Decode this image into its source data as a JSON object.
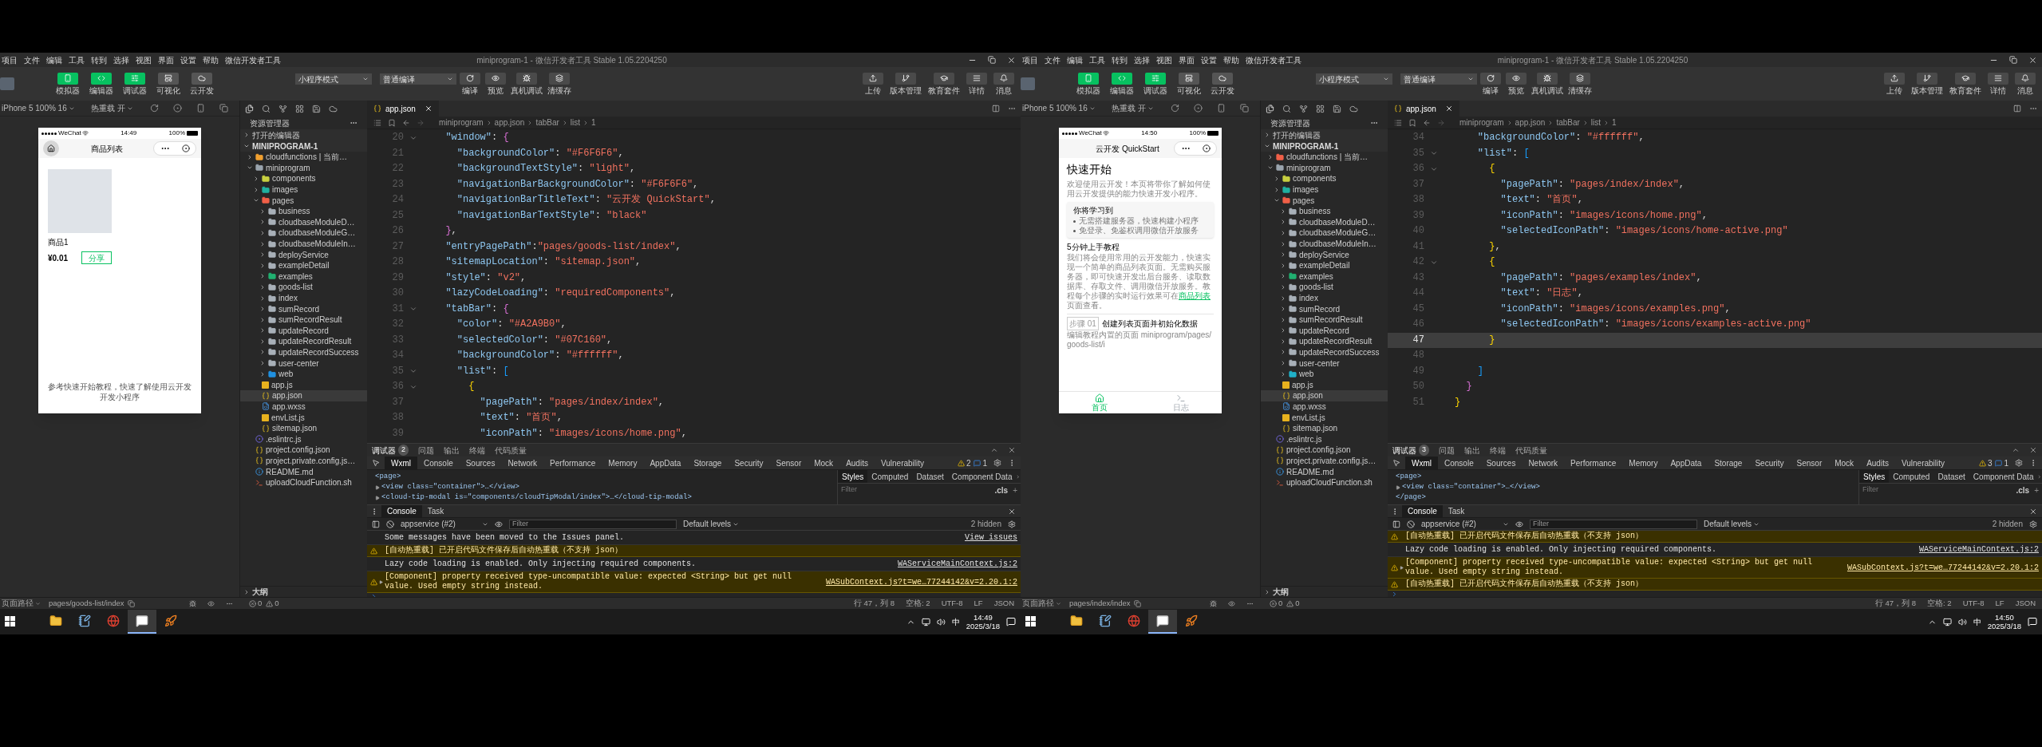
{
  "windows": [
    {
      "menu": [
        "项目",
        "文件",
        "编辑",
        "工具",
        "转到",
        "选择",
        "视图",
        "界面",
        "设置",
        "帮助",
        "微信开发者工具"
      ],
      "title": "miniprogram-1 - 微信开发者工具 Stable 1.05.2204250",
      "mode_buttons": [
        {
          "label": "模拟器",
          "kind": "simulator",
          "on": true
        },
        {
          "label": "编辑器",
          "kind": "editor",
          "on": true
        },
        {
          "label": "调试器",
          "kind": "debugger",
          "on": true
        },
        {
          "label": "可视化",
          "kind": "visual",
          "on": false
        },
        {
          "label": "云开发",
          "kind": "cloud",
          "on": false
        }
      ],
      "mode_select": "小程序模式",
      "compile_select": "普通编译",
      "compile_actions": [
        {
          "label": "编译",
          "kind": "compile"
        },
        {
          "label": "预览",
          "kind": "preview"
        },
        {
          "label": "真机调试",
          "kind": "device"
        },
        {
          "label": "清缓存",
          "kind": "cache"
        }
      ],
      "right_actions": [
        {
          "label": "上传",
          "kind": "upload"
        },
        {
          "label": "版本管理",
          "kind": "version"
        },
        {
          "label": "教育套件",
          "kind": "edu"
        },
        {
          "label": "详情",
          "kind": "details"
        },
        {
          "label": "消息",
          "kind": "messages"
        }
      ],
      "simulator": {
        "device": "iPhone 5 100% 16",
        "hot_reload": "热重载 开",
        "phone": {
          "kind": "goods",
          "carrier": "WeChat",
          "time": "14:49",
          "battery": "100%",
          "home_button": true,
          "title": "商品列表",
          "product": {
            "name": "商品1",
            "price": "¥0.01",
            "button": "分享"
          },
          "footer": "参考快速开始教程，快速了解使用云开发开发小程序"
        }
      },
      "explorer": {
        "title": "资源管理器",
        "open_editors": "打开的编辑器",
        "project": "MINIPROGRAM-1",
        "outline": "大纲",
        "tree": [
          {
            "name": "cloudfunctions | 当前…",
            "kind": "folder",
            "color": "#f0a030",
            "expanded": false,
            "selected": false
          },
          {
            "name": "miniprogram",
            "kind": "folder",
            "color": "#9aa4ad",
            "expanded": true,
            "selected": false,
            "children": [
              {
                "name": "components",
                "kind": "folder",
                "color": "#c8d040",
                "expanded": false,
                "selected": false
              },
              {
                "name": "images",
                "kind": "folder",
                "color": "#20b0a0",
                "expanded": false,
                "selected": false
              },
              {
                "name": "pages",
                "kind": "folder",
                "color": "#f06048",
                "expanded": true,
                "selected": false,
                "children": [
                  {
                    "name": "business",
                    "kind": "folder",
                    "color": "#a8b0b8",
                    "expanded": false,
                    "selected": false
                  },
                  {
                    "name": "cloudbaseModuleD…",
                    "kind": "folder",
                    "color": "#a8b0b8",
                    "expanded": false,
                    "selected": false
                  },
                  {
                    "name": "cloudbaseModuleG…",
                    "kind": "folder",
                    "color": "#a8b0b8",
                    "expanded": false,
                    "selected": false
                  },
                  {
                    "name": "cloudbaseModuleIn…",
                    "kind": "folder",
                    "color": "#a8b0b8",
                    "expanded": false,
                    "selected": false
                  },
                  {
                    "name": "deployService",
                    "kind": "folder",
                    "color": "#a8b0b8",
                    "expanded": false,
                    "selected": false
                  },
                  {
                    "name": "exampleDetail",
                    "kind": "folder",
                    "color": "#a8b0b8",
                    "expanded": false,
                    "selected": false
                  },
                  {
                    "name": "examples",
                    "kind": "folder",
                    "color": "#20b070",
                    "expanded": false,
                    "selected": false
                  },
                  {
                    "name": "goods-list",
                    "kind": "folder",
                    "color": "#a8b0b8",
                    "expanded": false,
                    "selected": false
                  },
                  {
                    "name": "index",
                    "kind": "folder",
                    "color": "#a8b0b8",
                    "expanded": false,
                    "selected": false
                  },
                  {
                    "name": "sumRecord",
                    "kind": "folder",
                    "color": "#a8b0b8",
                    "expanded": false,
                    "selected": false
                  },
                  {
                    "name": "sumRecordResult",
                    "kind": "folder",
                    "color": "#a8b0b8",
                    "expanded": false,
                    "selected": false
                  },
                  {
                    "name": "updateRecord",
                    "kind": "folder",
                    "color": "#a8b0b8",
                    "expanded": false,
                    "selected": false
                  },
                  {
                    "name": "updateRecordResult",
                    "kind": "folder",
                    "color": "#a8b0b8",
                    "expanded": false,
                    "selected": false
                  },
                  {
                    "name": "updateRecordSuccess",
                    "kind": "folder",
                    "color": "#a8b0b8",
                    "expanded": false,
                    "selected": false
                  },
                  {
                    "name": "user-center",
                    "kind": "folder",
                    "color": "#a8b0b8",
                    "expanded": false,
                    "selected": false
                  },
                  {
                    "name": "web",
                    "kind": "folder",
                    "color": "#2090e0",
                    "expanded": false,
                    "selected": false
                  }
                ]
              },
              {
                "name": "app.js",
                "kind": "js",
                "selected": false
              },
              {
                "name": "app.json",
                "kind": "json",
                "selected": true
              },
              {
                "name": "app.wxss",
                "kind": "wxss",
                "selected": false
              },
              {
                "name": "envList.js",
                "kind": "js",
                "selected": false
              },
              {
                "name": "sitemap.json",
                "kind": "json",
                "selected": false
              }
            ]
          },
          {
            "name": ".eslintrc.js",
            "kind": "eslint",
            "selected": false
          },
          {
            "name": "project.config.json",
            "kind": "json",
            "selected": false
          },
          {
            "name": "project.private.config.js…",
            "kind": "json",
            "selected": false
          },
          {
            "name": "README.md",
            "kind": "info",
            "selected": false
          },
          {
            "name": "uploadCloudFunction.sh",
            "kind": "shell",
            "selected": false
          }
        ]
      },
      "editor": {
        "tab": "app.json",
        "breadcrumb": [
          "miniprogram",
          "app.json",
          "tabBar",
          "list",
          "1"
        ],
        "lines": [
          {
            "n": "20",
            "text": "  \"window\": {",
            "fold": true,
            "current": false
          },
          {
            "n": "21",
            "text": "    \"backgroundColor\": \"#F6F6F6\",",
            "fold": false,
            "current": false
          },
          {
            "n": "22",
            "text": "    \"backgroundTextStyle\": \"light\",",
            "fold": false,
            "current": false
          },
          {
            "n": "23",
            "text": "    \"navigationBarBackgroundColor\": \"#F6F6F6\",",
            "fold": false,
            "current": false
          },
          {
            "n": "24",
            "text": "    \"navigationBarTitleText\": \"云开发 QuickStart\",",
            "fold": false,
            "current": false
          },
          {
            "n": "25",
            "text": "    \"navigationBarTextStyle\": \"black\"",
            "fold": false,
            "current": false
          },
          {
            "n": "26",
            "text": "  },",
            "fold": false,
            "current": false
          },
          {
            "n": "27",
            "text": "  \"entryPagePath\":\"pages/goods-list/index\",",
            "fold": false,
            "current": false
          },
          {
            "n": "28",
            "text": "  \"sitemapLocation\": \"sitemap.json\",",
            "fold": false,
            "current": false
          },
          {
            "n": "29",
            "text": "  \"style\": \"v2\",",
            "fold": false,
            "current": false
          },
          {
            "n": "30",
            "text": "  \"lazyCodeLoading\": \"requiredComponents\",",
            "fold": false,
            "current": false
          },
          {
            "n": "31",
            "text": "  \"tabBar\": {",
            "fold": true,
            "current": false
          },
          {
            "n": "32",
            "text": "    \"color\": \"#A2A9B0\",",
            "fold": false,
            "current": false
          },
          {
            "n": "33",
            "text": "    \"selectedColor\": \"#07C160\",",
            "fold": false,
            "current": false
          },
          {
            "n": "34",
            "text": "    \"backgroundColor\": \"#ffffff\",",
            "fold": false,
            "current": false
          },
          {
            "n": "35",
            "text": "    \"list\": [",
            "fold": true,
            "current": false
          },
          {
            "n": "36",
            "text": "      {",
            "fold": true,
            "current": false
          },
          {
            "n": "37",
            "text": "        \"pagePath\": \"pages/index/index\",",
            "fold": false,
            "current": false
          },
          {
            "n": "38",
            "text": "        \"text\": \"首页\",",
            "fold": false,
            "current": false
          },
          {
            "n": "39",
            "text": "        \"iconPath\": \"images/icons/home.png\",",
            "fold": false,
            "current": false
          }
        ]
      },
      "devtools": {
        "panel_tabs": [
          {
            "label": "调试器",
            "badge": "2",
            "selected": true
          },
          {
            "label": "问题",
            "selected": false
          },
          {
            "label": "输出",
            "selected": false
          },
          {
            "label": "终端",
            "selected": false
          },
          {
            "label": "代码质量",
            "selected": false
          }
        ],
        "tool_tabs": [
          {
            "label": "Wxml",
            "selected": true
          },
          {
            "label": "Console",
            "selected": false
          },
          {
            "label": "Sources",
            "selected": false
          },
          {
            "label": "Network",
            "selected": false
          },
          {
            "label": "Performance",
            "selected": false
          },
          {
            "label": "Memory",
            "selected": false
          },
          {
            "label": "AppData",
            "selected": false
          },
          {
            "label": "Storage",
            "selected": false
          },
          {
            "label": "Security",
            "selected": false
          },
          {
            "label": "Sensor",
            "selected": false
          },
          {
            "label": "Mock",
            "selected": false
          },
          {
            "label": "Audits",
            "selected": false
          },
          {
            "label": "Vulnerability",
            "selected": false
          }
        ],
        "warning_count": "2",
        "message_count": "1",
        "wxml": [
          {
            "text": "<page>",
            "expandable": false
          },
          {
            "text": "<view class=\"container\">…</view>",
            "expandable": true
          },
          {
            "text": "<cloud-tip-modal is=\"components/cloudTipModal/index\">…</cloud-tip-modal>",
            "expandable": true
          }
        ],
        "style_tabs": [
          {
            "label": "Styles",
            "selected": true
          },
          {
            "label": "Computed",
            "selected": false
          },
          {
            "label": "Dataset",
            "selected": false
          },
          {
            "label": "Component Data",
            "selected": false
          }
        ],
        "styles_filter": {
          "placeholder": "Filter"
        },
        "cls": ".cls",
        "add": "+",
        "drawer_tabs": [
          {
            "label": "Console",
            "selected": true
          },
          {
            "label": "Task",
            "selected": false
          }
        ],
        "context": "appservice (#2)",
        "console_filter": {
          "placeholder": "Filter"
        },
        "levels": "Default levels",
        "hidden": "2 hidden",
        "messages": [
          {
            "kind": "info",
            "text": "Some messages have been moved to the Issues panel.",
            "source": "View issues"
          },
          {
            "kind": "warning",
            "text": "[自动热重载] 已开启代码文件保存后自动热重载（不支持 json）"
          },
          {
            "kind": "info",
            "text": "Lazy code loading is enabled. Only injecting required components.",
            "source": "WAServiceMainContext.js:2"
          },
          {
            "kind": "warning",
            "text": "[Component] property received type-uncompatible value: expected <String> but get null value. Used empty string instead.",
            "source": "WASubContext.js?t=we…77244142&v=2.20.1:2",
            "expandable": true
          }
        ]
      },
      "status_bar": {
        "page_path_label": "页面路径",
        "page_path": "pages/goods-list/index",
        "errors": "0",
        "warnings": "0",
        "position": "行 47，列 8",
        "indent": "空格: 2",
        "encoding": "UTF-8",
        "eol": "LF",
        "language": "JSON"
      },
      "taskbar": {
        "apps": [
          {
            "kind": "folder",
            "active": false
          },
          {
            "kind": "notes",
            "active": false
          },
          {
            "kind": "browser",
            "active": false
          },
          {
            "kind": "wechat-devtools",
            "active": true
          },
          {
            "kind": "orange-app",
            "active": false
          }
        ],
        "ime": "中",
        "time": "14:49",
        "date": "2025/3/18"
      }
    },
    {
      "menu": [
        "项目",
        "文件",
        "编辑",
        "工具",
        "转到",
        "选择",
        "视图",
        "界面",
        "设置",
        "帮助",
        "微信开发者工具"
      ],
      "title": "miniprogram-1 - 微信开发者工具 Stable 1.05.2204250",
      "mode_buttons": [
        {
          "label": "模拟器",
          "kind": "simulator",
          "on": true
        },
        {
          "label": "编辑器",
          "kind": "editor",
          "on": true
        },
        {
          "label": "调试器",
          "kind": "debugger",
          "on": true
        },
        {
          "label": "可视化",
          "kind": "visual",
          "on": false
        },
        {
          "label": "云开发",
          "kind": "cloud",
          "on": false
        }
      ],
      "mode_select": "小程序模式",
      "compile_select": "普通编译",
      "compile_actions": [
        {
          "label": "编译",
          "kind": "compile"
        },
        {
          "label": "预览",
          "kind": "preview"
        },
        {
          "label": "真机调试",
          "kind": "device"
        },
        {
          "label": "清缓存",
          "kind": "cache"
        }
      ],
      "right_actions": [
        {
          "label": "上传",
          "kind": "upload"
        },
        {
          "label": "版本管理",
          "kind": "version"
        },
        {
          "label": "教育套件",
          "kind": "edu"
        },
        {
          "label": "详情",
          "kind": "details"
        },
        {
          "label": "消息",
          "kind": "messages"
        }
      ],
      "simulator": {
        "device": "iPhone 5 100% 16",
        "hot_reload": "热重载 开",
        "phone": {
          "kind": "quickstart",
          "carrier": "WeChat",
          "time": "14:50",
          "battery": "100%",
          "home_button": false,
          "title": "云开发 QuickStart",
          "heading": "快速开始",
          "intro": "欢迎使用云开发！本页将带你了解如何使用云开发提供的能力快速开发小程序。",
          "card": {
            "title": "你将学习到",
            "bullets": [
              "无需搭建服务器，快速构建小程序",
              "免登录、免鉴权调用微信开放服务"
            ]
          },
          "section": "5分钟上手教程",
          "body_before": "我们将会使用常用的云开发能力，快速实现一个简单的商品列表页面。无需购买服务器，即可快速开发出后台服务、读取数据库、存取文件、调用微信开放服务。教程每个步骤的实时运行效果可在",
          "link": "商品列表",
          "body_after": "页面查看。",
          "step": {
            "badge": "步骤 01",
            "title": "创建列表页面并初始化数据",
            "desc": "编辑教程内置的页面 miniprogram/pages/goods-list/i"
          },
          "tabs": [
            {
              "label": "首页",
              "kind": "home",
              "selected": true
            },
            {
              "label": "日志",
              "kind": "log",
              "selected": false
            }
          ]
        }
      },
      "explorer": {
        "title": "资源管理器",
        "open_editors": "打开的编辑器",
        "project": "MINIPROGRAM-1",
        "outline": "大纲",
        "tree": [
          {
            "name": "cloudfunctions | 当前…",
            "kind": "folder",
            "color": "#f06048",
            "expanded": false,
            "selected": false
          },
          {
            "name": "miniprogram",
            "kind": "folder",
            "color": "#9aa4ad",
            "expanded": true,
            "selected": false,
            "children": [
              {
                "name": "components",
                "kind": "folder",
                "color": "#c8d040",
                "expanded": false,
                "selected": false
              },
              {
                "name": "images",
                "kind": "folder",
                "color": "#20b0a0",
                "expanded": false,
                "selected": false
              },
              {
                "name": "pages",
                "kind": "folder",
                "color": "#f06048",
                "expanded": true,
                "selected": false,
                "children": [
                  {
                    "name": "business",
                    "kind": "folder",
                    "color": "#a8b0b8",
                    "expanded": false,
                    "selected": false
                  },
                  {
                    "name": "cloudbaseModuleD…",
                    "kind": "folder",
                    "color": "#a8b0b8",
                    "expanded": false,
                    "selected": false
                  },
                  {
                    "name": "cloudbaseModuleG…",
                    "kind": "folder",
                    "color": "#a8b0b8",
                    "expanded": false,
                    "selected": false
                  },
                  {
                    "name": "cloudbaseModuleIn…",
                    "kind": "folder",
                    "color": "#a8b0b8",
                    "expanded": false,
                    "selected": false
                  },
                  {
                    "name": "deployService",
                    "kind": "folder",
                    "color": "#a8b0b8",
                    "expanded": false,
                    "selected": false
                  },
                  {
                    "name": "exampleDetail",
                    "kind": "folder",
                    "color": "#a8b0b8",
                    "expanded": false,
                    "selected": false
                  },
                  {
                    "name": "examples",
                    "kind": "folder",
                    "color": "#20b070",
                    "expanded": false,
                    "selected": false
                  },
                  {
                    "name": "goods-list",
                    "kind": "folder",
                    "color": "#a8b0b8",
                    "expanded": false,
                    "selected": false
                  },
                  {
                    "name": "index",
                    "kind": "folder",
                    "color": "#a8b0b8",
                    "expanded": false,
                    "selected": false
                  },
                  {
                    "name": "sumRecord",
                    "kind": "folder",
                    "color": "#a8b0b8",
                    "expanded": false,
                    "selected": false
                  },
                  {
                    "name": "sumRecordResult",
                    "kind": "folder",
                    "color": "#a8b0b8",
                    "expanded": false,
                    "selected": false
                  },
                  {
                    "name": "updateRecord",
                    "kind": "folder",
                    "color": "#a8b0b8",
                    "expanded": false,
                    "selected": false
                  },
                  {
                    "name": "updateRecordResult",
                    "kind": "folder",
                    "color": "#a8b0b8",
                    "expanded": false,
                    "selected": false
                  },
                  {
                    "name": "updateRecordSuccess",
                    "kind": "folder",
                    "color": "#a8b0b8",
                    "expanded": false,
                    "selected": false
                  },
                  {
                    "name": "user-center",
                    "kind": "folder",
                    "color": "#a8b0b8",
                    "expanded": false,
                    "selected": false
                  },
                  {
                    "name": "web",
                    "kind": "folder",
                    "color": "#20b0c8",
                    "expanded": false,
                    "selected": false
                  }
                ]
              },
              {
                "name": "app.js",
                "kind": "js",
                "selected": false
              },
              {
                "name": "app.json",
                "kind": "json",
                "selected": true
              },
              {
                "name": "app.wxss",
                "kind": "wxss",
                "selected": false
              },
              {
                "name": "envList.js",
                "kind": "js",
                "selected": false
              },
              {
                "name": "sitemap.json",
                "kind": "json",
                "selected": false
              }
            ]
          },
          {
            "name": ".eslintrc.js",
            "kind": "eslint",
            "selected": false
          },
          {
            "name": "project.config.json",
            "kind": "json",
            "selected": false
          },
          {
            "name": "project.private.config.js…",
            "kind": "json",
            "selected": false
          },
          {
            "name": "README.md",
            "kind": "info",
            "selected": false
          },
          {
            "name": "uploadCloudFunction.sh",
            "kind": "shell",
            "selected": false
          }
        ]
      },
      "editor": {
        "tab": "app.json",
        "breadcrumb": [
          "miniprogram",
          "app.json",
          "tabBar",
          "list",
          "1"
        ],
        "lines": [
          {
            "n": "34",
            "text": "    \"backgroundColor\": \"#ffffff\",",
            "fold": false,
            "current": false
          },
          {
            "n": "35",
            "text": "    \"list\": [",
            "fold": true,
            "current": false
          },
          {
            "n": "36",
            "text": "      {",
            "fold": true,
            "current": false
          },
          {
            "n": "37",
            "text": "        \"pagePath\": \"pages/index/index\",",
            "fold": false,
            "current": false
          },
          {
            "n": "38",
            "text": "        \"text\": \"首页\",",
            "fold": false,
            "current": false
          },
          {
            "n": "39",
            "text": "        \"iconPath\": \"images/icons/home.png\",",
            "fold": false,
            "current": false
          },
          {
            "n": "40",
            "text": "        \"selectedIconPath\": \"images/icons/home-active.png\"",
            "fold": false,
            "current": false
          },
          {
            "n": "41",
            "text": "      },",
            "fold": false,
            "current": false
          },
          {
            "n": "42",
            "text": "      {",
            "fold": true,
            "current": false
          },
          {
            "n": "43",
            "text": "        \"pagePath\": \"pages/examples/index\",",
            "fold": false,
            "current": false
          },
          {
            "n": "44",
            "text": "        \"text\": \"日志\",",
            "fold": false,
            "current": false
          },
          {
            "n": "45",
            "text": "        \"iconPath\": \"images/icons/examples.png\",",
            "fold": false,
            "current": false
          },
          {
            "n": "46",
            "text": "        \"selectedIconPath\": \"images/icons/examples-active.png\"",
            "fold": false,
            "current": false
          },
          {
            "n": "47",
            "text": "      }",
            "fold": false,
            "current": true
          },
          {
            "n": "48",
            "fold": false,
            "current": false
          },
          {
            "n": "49",
            "text": "    ]",
            "fold": false,
            "current": false
          },
          {
            "n": "50",
            "text": "  }",
            "fold": false,
            "current": false
          },
          {
            "n": "51",
            "text": "}",
            "fold": false,
            "current": false
          }
        ]
      },
      "devtools": {
        "panel_tabs": [
          {
            "label": "调试器",
            "badge": "3",
            "selected": true
          },
          {
            "label": "问题",
            "selected": false
          },
          {
            "label": "输出",
            "selected": false
          },
          {
            "label": "终端",
            "selected": false
          },
          {
            "label": "代码质量",
            "selected": false
          }
        ],
        "tool_tabs": [
          {
            "label": "Wxml",
            "selected": true
          },
          {
            "label": "Console",
            "selected": false
          },
          {
            "label": "Sources",
            "selected": false
          },
          {
            "label": "Network",
            "selected": false
          },
          {
            "label": "Performance",
            "selected": false
          },
          {
            "label": "Memory",
            "selected": false
          },
          {
            "label": "AppData",
            "selected": false
          },
          {
            "label": "Storage",
            "selected": false
          },
          {
            "label": "Security",
            "selected": false
          },
          {
            "label": "Sensor",
            "selected": false
          },
          {
            "label": "Mock",
            "selected": false
          },
          {
            "label": "Audits",
            "selected": false
          },
          {
            "label": "Vulnerability",
            "selected": false
          }
        ],
        "warning_count": "3",
        "message_count": "1",
        "wxml": [
          {
            "text": "<page>",
            "expandable": false
          },
          {
            "text": "<view class=\"container\">…</view>",
            "expandable": true
          },
          {
            "text": "</page>",
            "expandable": false
          }
        ],
        "style_tabs": [
          {
            "label": "Styles",
            "selected": true
          },
          {
            "label": "Computed",
            "selected": false
          },
          {
            "label": "Dataset",
            "selected": false
          },
          {
            "label": "Component Data",
            "selected": false
          }
        ],
        "styles_filter": {
          "placeholder": "Filter"
        },
        "cls": ".cls",
        "add": "+",
        "drawer_tabs": [
          {
            "label": "Console",
            "selected": true
          },
          {
            "label": "Task",
            "selected": false
          }
        ],
        "context": "appservice (#2)",
        "console_filter": {
          "placeholder": "Filter"
        },
        "levels": "Default levels",
        "hidden": "2 hidden",
        "messages": [
          {
            "kind": "warning",
            "text": "[自动热重载] 已开启代码文件保存后自动热重载（不支持 json）"
          },
          {
            "kind": "info",
            "text": "Lazy code loading is enabled. Only injecting required components.",
            "source": "WAServiceMainContext.js:2"
          },
          {
            "kind": "warning",
            "text": "[Component] property received type-uncompatible value: expected <String> but get null value. Used empty string instead.",
            "source": "WASubContext.js?t=we…77244142&v=2.20.1:2",
            "expandable": true
          },
          {
            "kind": "warning",
            "text": "[自动热重载] 已开启代码文件保存后自动热重载（不支持 json）"
          }
        ]
      },
      "status_bar": {
        "page_path_label": "页面路径",
        "page_path": "pages/index/index",
        "errors": "0",
        "warnings": "0",
        "position": "行 47，列 8",
        "indent": "空格: 2",
        "encoding": "UTF-8",
        "eol": "LF",
        "language": "JSON"
      },
      "taskbar": {
        "apps": [
          {
            "kind": "folder",
            "active": false
          },
          {
            "kind": "notes",
            "active": false
          },
          {
            "kind": "browser",
            "active": false
          },
          {
            "kind": "wechat-devtools",
            "active": true
          },
          {
            "kind": "orange-app",
            "active": false
          }
        ],
        "ime": "中",
        "time": "14:50",
        "date": "2025/3/18"
      }
    }
  ]
}
